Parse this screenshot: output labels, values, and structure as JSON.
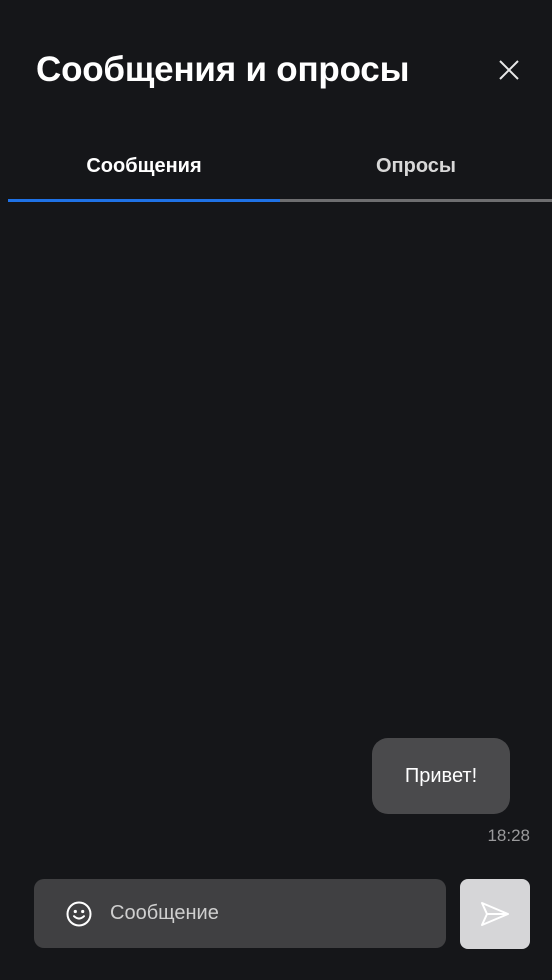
{
  "header": {
    "title": "Сообщения и опросы",
    "close_icon": "close-icon"
  },
  "tabs": [
    {
      "label": "Сообщения",
      "active": true
    },
    {
      "label": "Опросы",
      "active": false
    }
  ],
  "messages": [
    {
      "text": "Привет!",
      "time": "18:28",
      "outgoing": true
    }
  ],
  "composer": {
    "placeholder": "Сообщение",
    "value": "",
    "emoji_icon": "smile-icon",
    "send_icon": "send-icon"
  },
  "colors": {
    "background": "#151619",
    "accent": "#1f72e6",
    "bubble": "#4a4a4c",
    "input": "#404042",
    "send_disabled": "#d6d6d8"
  }
}
